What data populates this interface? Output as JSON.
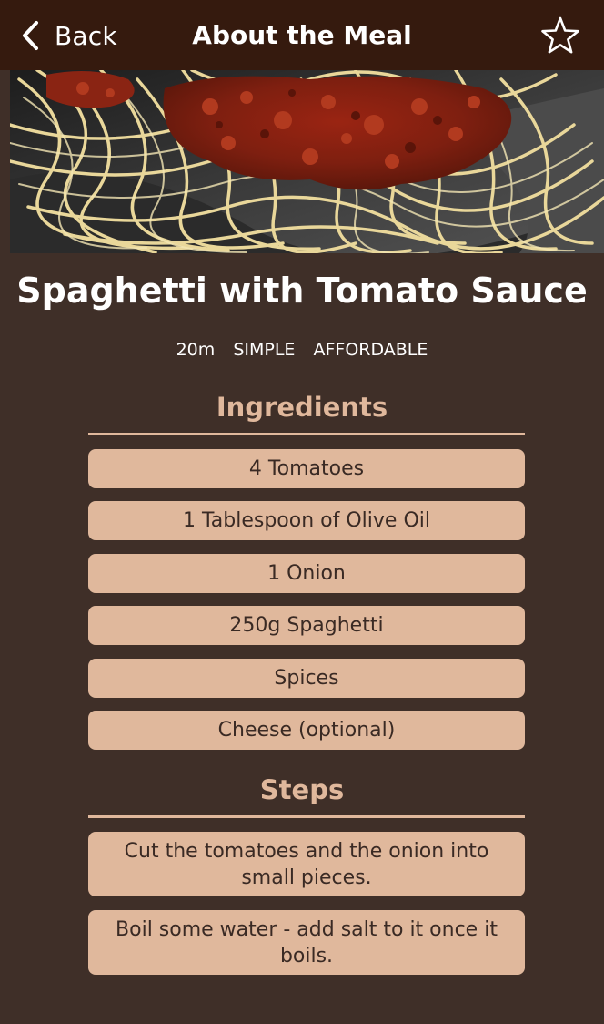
{
  "nav": {
    "back_label": "Back",
    "title": "About the Meal"
  },
  "meal": {
    "title": "Spaghetti with Tomato Sauce",
    "duration": "20m",
    "complexity": "SIMPLE",
    "affordability": "AFFORDABLE"
  },
  "ingredients_title": "Ingredients",
  "ingredients": [
    "4 Tomatoes",
    "1 Tablespoon of Olive Oil",
    "1 Onion",
    "250g Spaghetti",
    "Spices",
    "Cheese (optional)"
  ],
  "steps_title": "Steps",
  "steps": [
    "Cut the tomatoes and the onion into small pieces.",
    "Boil some water - add salt to it once it boils."
  ],
  "icons": {
    "back": "chevron-left-icon",
    "favorite": "star-outline-icon"
  },
  "colors": {
    "header": "#351a0e",
    "background": "#3f2f28",
    "accent": "#e0b89c"
  }
}
